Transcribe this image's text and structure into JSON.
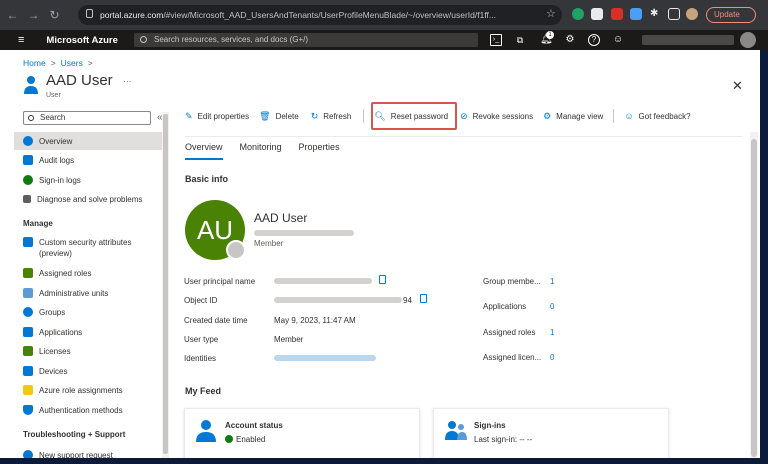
{
  "browser": {
    "url_host": "portal.azure.com",
    "url_path": "/#view/Microsoft_AAD_UsersAndTenants/UserProfileMenuBlade/~/overview/userId/f1ff...",
    "update_label": "Update"
  },
  "azure": {
    "title": "Microsoft Azure",
    "search_placeholder": "Search resources, services, and docs (G+/)",
    "notification_count": "1"
  },
  "breadcrumb": [
    "Home",
    "Users"
  ],
  "page": {
    "title": "AAD User",
    "subtitle": "User"
  },
  "leftnav": {
    "search_placeholder": "Search",
    "items_top": [
      "Overview",
      "Audit logs",
      "Sign-in logs",
      "Diagnose and solve problems"
    ],
    "manage_heading": "Manage",
    "manage_items": [
      "Custom security attributes (preview)",
      "Assigned roles",
      "Administrative units",
      "Groups",
      "Applications",
      "Licenses",
      "Devices",
      "Azure role assignments",
      "Authentication methods"
    ],
    "support_heading": "Troubleshooting + Support",
    "support_items": [
      "New support request"
    ]
  },
  "toolbar": {
    "edit": "Edit properties",
    "delete": "Delete",
    "refresh": "Refresh",
    "reset": "Reset password",
    "revoke": "Revoke sessions",
    "manage_view": "Manage view",
    "feedback": "Got feedback?"
  },
  "tabs": [
    "Overview",
    "Monitoring",
    "Properties"
  ],
  "basic_info": {
    "heading": "Basic info",
    "initials": "AU",
    "name": "AAD User",
    "member_label": "Member",
    "left_props": [
      {
        "label": "User principal name",
        "value": ""
      },
      {
        "label": "Object ID",
        "value": "94"
      },
      {
        "label": "Created date time",
        "value": "May 9, 2023, 11:47 AM"
      },
      {
        "label": "User type",
        "value": "Member"
      },
      {
        "label": "Identities",
        "value": ""
      }
    ],
    "right_props": [
      {
        "label": "Group membe...",
        "value": "1"
      },
      {
        "label": "Applications",
        "value": "0"
      },
      {
        "label": "Assigned roles",
        "value": "1"
      },
      {
        "label": "Assigned licen...",
        "value": "0"
      }
    ]
  },
  "feed": {
    "heading": "My Feed",
    "account_status_title": "Account status",
    "account_status_value": "Enabled",
    "signins_title": "Sign-ins",
    "signins_value": "Last sign-in: -- --"
  },
  "colors": {
    "accent": "#0078d4",
    "avatar": "#498205",
    "highlight": "#d9534f",
    "enabled": "#107c10"
  }
}
